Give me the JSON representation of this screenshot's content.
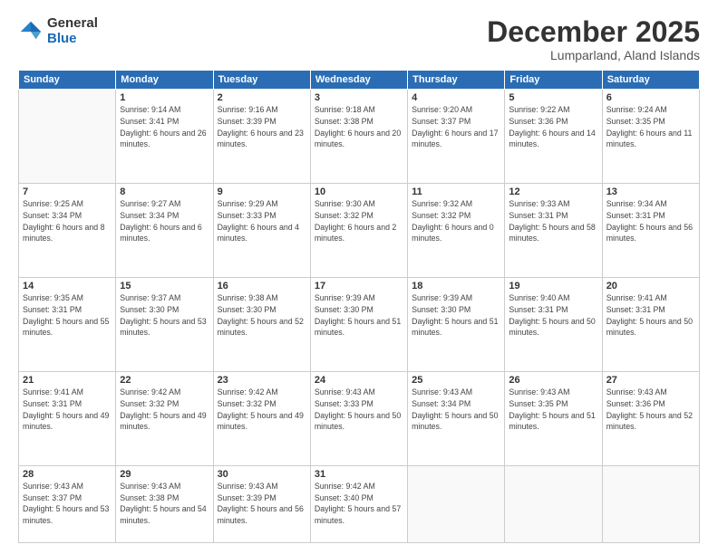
{
  "logo": {
    "general": "General",
    "blue": "Blue"
  },
  "header": {
    "month": "December 2025",
    "location": "Lumparland, Aland Islands"
  },
  "days_of_week": [
    "Sunday",
    "Monday",
    "Tuesday",
    "Wednesday",
    "Thursday",
    "Friday",
    "Saturday"
  ],
  "weeks": [
    [
      {
        "day": "",
        "info": ""
      },
      {
        "day": "1",
        "info": "Sunrise: 9:14 AM\nSunset: 3:41 PM\nDaylight: 6 hours\nand 26 minutes."
      },
      {
        "day": "2",
        "info": "Sunrise: 9:16 AM\nSunset: 3:39 PM\nDaylight: 6 hours\nand 23 minutes."
      },
      {
        "day": "3",
        "info": "Sunrise: 9:18 AM\nSunset: 3:38 PM\nDaylight: 6 hours\nand 20 minutes."
      },
      {
        "day": "4",
        "info": "Sunrise: 9:20 AM\nSunset: 3:37 PM\nDaylight: 6 hours\nand 17 minutes."
      },
      {
        "day": "5",
        "info": "Sunrise: 9:22 AM\nSunset: 3:36 PM\nDaylight: 6 hours\nand 14 minutes."
      },
      {
        "day": "6",
        "info": "Sunrise: 9:24 AM\nSunset: 3:35 PM\nDaylight: 6 hours\nand 11 minutes."
      }
    ],
    [
      {
        "day": "7",
        "info": "Sunrise: 9:25 AM\nSunset: 3:34 PM\nDaylight: 6 hours\nand 8 minutes."
      },
      {
        "day": "8",
        "info": "Sunrise: 9:27 AM\nSunset: 3:34 PM\nDaylight: 6 hours\nand 6 minutes."
      },
      {
        "day": "9",
        "info": "Sunrise: 9:29 AM\nSunset: 3:33 PM\nDaylight: 6 hours\nand 4 minutes."
      },
      {
        "day": "10",
        "info": "Sunrise: 9:30 AM\nSunset: 3:32 PM\nDaylight: 6 hours\nand 2 minutes."
      },
      {
        "day": "11",
        "info": "Sunrise: 9:32 AM\nSunset: 3:32 PM\nDaylight: 6 hours\nand 0 minutes."
      },
      {
        "day": "12",
        "info": "Sunrise: 9:33 AM\nSunset: 3:31 PM\nDaylight: 5 hours\nand 58 minutes."
      },
      {
        "day": "13",
        "info": "Sunrise: 9:34 AM\nSunset: 3:31 PM\nDaylight: 5 hours\nand 56 minutes."
      }
    ],
    [
      {
        "day": "14",
        "info": "Sunrise: 9:35 AM\nSunset: 3:31 PM\nDaylight: 5 hours\nand 55 minutes."
      },
      {
        "day": "15",
        "info": "Sunrise: 9:37 AM\nSunset: 3:30 PM\nDaylight: 5 hours\nand 53 minutes."
      },
      {
        "day": "16",
        "info": "Sunrise: 9:38 AM\nSunset: 3:30 PM\nDaylight: 5 hours\nand 52 minutes."
      },
      {
        "day": "17",
        "info": "Sunrise: 9:39 AM\nSunset: 3:30 PM\nDaylight: 5 hours\nand 51 minutes."
      },
      {
        "day": "18",
        "info": "Sunrise: 9:39 AM\nSunset: 3:30 PM\nDaylight: 5 hours\nand 51 minutes."
      },
      {
        "day": "19",
        "info": "Sunrise: 9:40 AM\nSunset: 3:31 PM\nDaylight: 5 hours\nand 50 minutes."
      },
      {
        "day": "20",
        "info": "Sunrise: 9:41 AM\nSunset: 3:31 PM\nDaylight: 5 hours\nand 50 minutes."
      }
    ],
    [
      {
        "day": "21",
        "info": "Sunrise: 9:41 AM\nSunset: 3:31 PM\nDaylight: 5 hours\nand 49 minutes."
      },
      {
        "day": "22",
        "info": "Sunrise: 9:42 AM\nSunset: 3:32 PM\nDaylight: 5 hours\nand 49 minutes."
      },
      {
        "day": "23",
        "info": "Sunrise: 9:42 AM\nSunset: 3:32 PM\nDaylight: 5 hours\nand 49 minutes."
      },
      {
        "day": "24",
        "info": "Sunrise: 9:43 AM\nSunset: 3:33 PM\nDaylight: 5 hours\nand 50 minutes."
      },
      {
        "day": "25",
        "info": "Sunrise: 9:43 AM\nSunset: 3:34 PM\nDaylight: 5 hours\nand 50 minutes."
      },
      {
        "day": "26",
        "info": "Sunrise: 9:43 AM\nSunset: 3:35 PM\nDaylight: 5 hours\nand 51 minutes."
      },
      {
        "day": "27",
        "info": "Sunrise: 9:43 AM\nSunset: 3:36 PM\nDaylight: 5 hours\nand 52 minutes."
      }
    ],
    [
      {
        "day": "28",
        "info": "Sunrise: 9:43 AM\nSunset: 3:37 PM\nDaylight: 5 hours\nand 53 minutes."
      },
      {
        "day": "29",
        "info": "Sunrise: 9:43 AM\nSunset: 3:38 PM\nDaylight: 5 hours\nand 54 minutes."
      },
      {
        "day": "30",
        "info": "Sunrise: 9:43 AM\nSunset: 3:39 PM\nDaylight: 5 hours\nand 56 minutes."
      },
      {
        "day": "31",
        "info": "Sunrise: 9:42 AM\nSunset: 3:40 PM\nDaylight: 5 hours\nand 57 minutes."
      },
      {
        "day": "",
        "info": ""
      },
      {
        "day": "",
        "info": ""
      },
      {
        "day": "",
        "info": ""
      }
    ]
  ]
}
